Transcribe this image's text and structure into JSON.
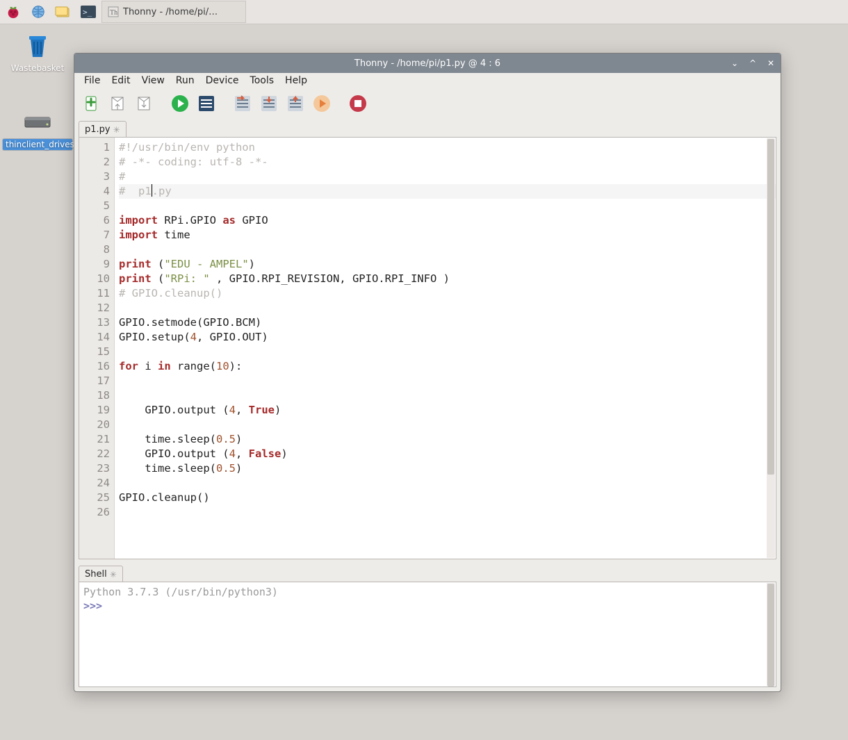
{
  "taskbar": {
    "app_title": "Thonny  -  /home/pi/…"
  },
  "desktop": {
    "wastebasket": "Wastebasket",
    "thinclient": "thinclient_drives"
  },
  "window": {
    "title": "Thonny  -  /home/pi/p1.py  @  4 : 6",
    "menu": [
      "File",
      "Edit",
      "View",
      "Run",
      "Device",
      "Tools",
      "Help"
    ],
    "toolbar_names": [
      "new",
      "open",
      "save",
      "run",
      "debug",
      "step-over",
      "step-into",
      "step-out",
      "resume",
      "stop"
    ],
    "tab": {
      "label": "p1.py"
    },
    "code_lines": 26,
    "cursor_line": 4,
    "lines": {
      "1": {
        "type": "comment",
        "text": "#!/usr/bin/env python"
      },
      "2": {
        "type": "comment",
        "text": "# -*- coding: utf-8 -*-"
      },
      "3": {
        "type": "comment",
        "text": "#"
      },
      "4": {
        "type": "comment",
        "text": "#  p1.py"
      },
      "5": {
        "type": "blank",
        "text": ""
      },
      "6": {
        "type": "import",
        "kw1": "import",
        "mid": " RPi.GPIO ",
        "kw2": "as",
        "tail": " GPIO"
      },
      "7": {
        "type": "import",
        "kw1": "import",
        "mid": " time",
        "kw2": "",
        "tail": ""
      },
      "8": {
        "type": "blank",
        "text": ""
      },
      "9": {
        "type": "print2",
        "fn": "print",
        "open": " (",
        "str": "\"EDU - AMPEL\"",
        "close": ")"
      },
      "10": {
        "type": "print3",
        "fn": "print",
        "open": " (",
        "str": "\"RPi: \"",
        "rest": " , GPIO.RPI_REVISION, GPIO.RPI_INFO )"
      },
      "11": {
        "type": "comment",
        "text": "# GPIO.cleanup()"
      },
      "12": {
        "type": "blank",
        "text": ""
      },
      "13": {
        "type": "plain",
        "text": "GPIO.setmode(GPIO.BCM)"
      },
      "14": {
        "type": "setup",
        "pre": "GPIO.setup(",
        "num": "4",
        "post": ", GPIO.OUT)"
      },
      "15": {
        "type": "blank",
        "text": ""
      },
      "16": {
        "type": "for",
        "kw1": "for",
        "mid1": " i ",
        "kw2": "in",
        "mid2": " range(",
        "num": "10",
        "post": "):"
      },
      "17": {
        "type": "blank",
        "text": ""
      },
      "18": {
        "type": "indent_blank",
        "text": "    "
      },
      "19": {
        "type": "call_bool",
        "pre": "    GPIO.output (",
        "num": "4",
        "sep": ", ",
        "bool": "True",
        "post": ")"
      },
      "20": {
        "type": "blank",
        "text": ""
      },
      "21": {
        "type": "call_num",
        "pre": "    time.sleep(",
        "num": "0.5",
        "post": ")"
      },
      "22": {
        "type": "call_bool",
        "pre": "    GPIO.output (",
        "num": "4",
        "sep": ", ",
        "bool": "False",
        "post": ")"
      },
      "23": {
        "type": "call_num",
        "pre": "    time.sleep(",
        "num": "0.5",
        "post": ")"
      },
      "24": {
        "type": "indent_blank",
        "text": "    "
      },
      "25": {
        "type": "plain",
        "text": "GPIO.cleanup()"
      },
      "26": {
        "type": "blank",
        "text": ""
      }
    },
    "shell_tab": "Shell",
    "shell_info": "Python 3.7.3 (/usr/bin/python3)",
    "shell_prompt": ">>> "
  }
}
